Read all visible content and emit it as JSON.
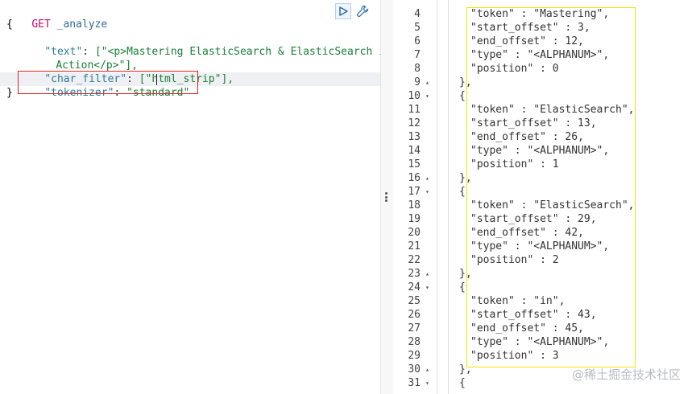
{
  "request": {
    "method": "GET",
    "endpoint": "_analyze",
    "open_brace": "{",
    "close_brace": "}",
    "text_key": "\"text\"",
    "text_value_1": "[\"<p>Mastering ElasticSearch & ElasticSearch in",
    "text_value_2": "Action</p>\"],",
    "char_filter_key": "\"char_filter\"",
    "char_filter_value": "[\"html_strip\"],",
    "tokenizer_key": "\"tokenizer\"",
    "tokenizer_value": "\"standard\""
  },
  "toolbar": {
    "run_icon": "play-icon",
    "settings_icon": "wrench-icon"
  },
  "response": {
    "lines": [
      {
        "num": "4",
        "fold": "",
        "text": "\"token\" : \"Mastering\","
      },
      {
        "num": "5",
        "fold": "",
        "text": "\"start_offset\" : 3,"
      },
      {
        "num": "6",
        "fold": "",
        "text": "\"end_offset\" : 12,"
      },
      {
        "num": "7",
        "fold": "",
        "text": "\"type\" : \"<ALPHANUM>\","
      },
      {
        "num": "8",
        "fold": "",
        "text": "\"position\" : 0"
      },
      {
        "num": "9",
        "fold": "▴",
        "text": "},"
      },
      {
        "num": "10",
        "fold": "▾",
        "text": "{"
      },
      {
        "num": "11",
        "fold": "",
        "text": "\"token\" : \"ElasticSearch\","
      },
      {
        "num": "12",
        "fold": "",
        "text": "\"start_offset\" : 13,"
      },
      {
        "num": "13",
        "fold": "",
        "text": "\"end_offset\" : 26,"
      },
      {
        "num": "14",
        "fold": "",
        "text": "\"type\" : \"<ALPHANUM>\","
      },
      {
        "num": "15",
        "fold": "",
        "text": "\"position\" : 1"
      },
      {
        "num": "16",
        "fold": "▴",
        "text": "},"
      },
      {
        "num": "17",
        "fold": "▾",
        "text": "{"
      },
      {
        "num": "18",
        "fold": "",
        "text": "\"token\" : \"ElasticSearch\","
      },
      {
        "num": "19",
        "fold": "",
        "text": "\"start_offset\" : 29,"
      },
      {
        "num": "20",
        "fold": "",
        "text": "\"end_offset\" : 42,"
      },
      {
        "num": "21",
        "fold": "",
        "text": "\"type\" : \"<ALPHANUM>\","
      },
      {
        "num": "22",
        "fold": "",
        "text": "\"position\" : 2"
      },
      {
        "num": "23",
        "fold": "▴",
        "text": "},"
      },
      {
        "num": "24",
        "fold": "▾",
        "text": "{"
      },
      {
        "num": "25",
        "fold": "",
        "text": "\"token\" : \"in\","
      },
      {
        "num": "26",
        "fold": "",
        "text": "\"start_offset\" : 43,"
      },
      {
        "num": "27",
        "fold": "",
        "text": "\"end_offset\" : 45,"
      },
      {
        "num": "28",
        "fold": "",
        "text": "\"type\" : \"<ALPHANUM>\","
      },
      {
        "num": "29",
        "fold": "",
        "text": "\"position\" : 3"
      },
      {
        "num": "30",
        "fold": "▴",
        "text": "},"
      },
      {
        "num": "31",
        "fold": "▾",
        "text": "{"
      }
    ]
  },
  "watermark": "@稀土掘金技术社区",
  "colors": {
    "highlight_box": "#e02020",
    "result_box": "#f5e200"
  }
}
